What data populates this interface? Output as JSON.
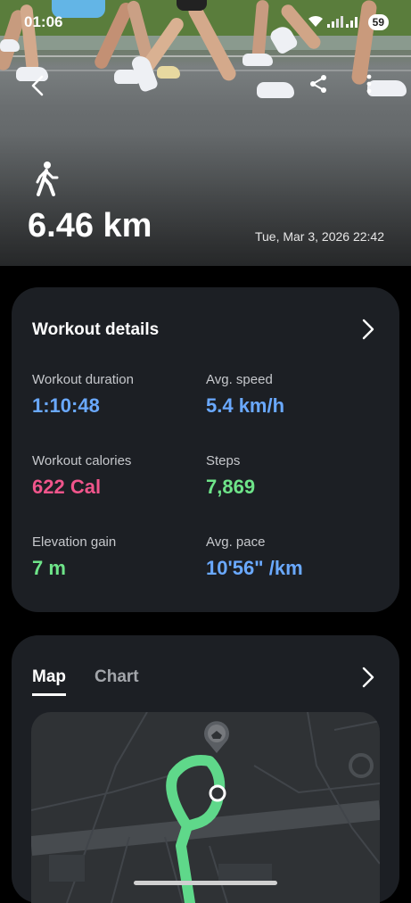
{
  "status": {
    "time": "01:06",
    "battery": "59"
  },
  "header": {
    "back_icon": "chevron-left-icon",
    "share_icon": "share-icon",
    "more_icon": "more-vertical-icon",
    "activity_icon": "walking-person-icon",
    "distance": "6.46 km",
    "datetime": "Tue, Mar 3, 2026 22:42"
  },
  "workout_details": {
    "title": "Workout details",
    "metrics": [
      {
        "label": "Workout duration",
        "value": "1:10:48",
        "color": "#6aa9ff"
      },
      {
        "label": "Avg. speed",
        "value": "5.4 km/h",
        "color": "#6aa9ff"
      },
      {
        "label": "Workout calories",
        "value": "622 Cal",
        "color": "#f0558b"
      },
      {
        "label": "Steps",
        "value": "7,869",
        "color": "#6ee489"
      },
      {
        "label": "Elevation gain",
        "value": "7 m",
        "color": "#6ee489"
      },
      {
        "label": "Avg. pace",
        "value": "10'56\" /km",
        "color": "#6aa9ff"
      }
    ]
  },
  "map_section": {
    "tabs": [
      {
        "label": "Map",
        "active": true
      },
      {
        "label": "Chart",
        "active": false
      }
    ],
    "route_color": "#5fd88a"
  }
}
